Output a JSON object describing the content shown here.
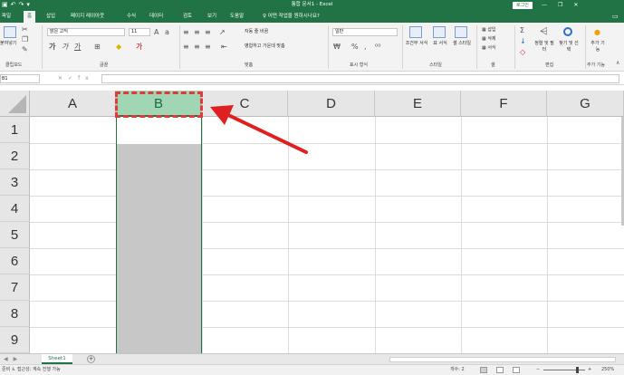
{
  "window": {
    "title": "통합 문서1 - Excel",
    "login_label": "로그인",
    "qat_icons": [
      "save-icon",
      "undo-icon",
      "redo-icon",
      "customize-icon"
    ],
    "controls": [
      "minimize-icon",
      "restore-icon",
      "close-icon"
    ]
  },
  "tabs": [
    "파일",
    "홈",
    "삽입",
    "페이지 레이아웃",
    "수식",
    "데이터",
    "검토",
    "보기",
    "도움말"
  ],
  "active_tab": "홈",
  "tell_me": "어떤 작업을 원하시나요?",
  "ribbon": {
    "clipboard": {
      "paste_label": "붙여넣기",
      "group": "클립보드"
    },
    "font": {
      "name": "맑은 고딕",
      "size": "11",
      "group": "글꼴"
    },
    "alignment": {
      "wrap_text": "자동 줄 바꿈",
      "merge_center": "병합하고 가운데 맞춤",
      "group": "맞춤"
    },
    "number": {
      "format": "일반",
      "group": "표시 형식"
    },
    "styles": {
      "conditional": "조건부 서식",
      "table": "표 서식",
      "cell": "셀 스타일",
      "group": "스타일"
    },
    "cells": {
      "insert": "삽입",
      "delete": "삭제",
      "format": "서식",
      "group": "셀"
    },
    "editing": {
      "sort": "정렬 및 필터",
      "find": "찾기 및 선택",
      "group": "편집"
    },
    "addins": {
      "label": "추가 기능",
      "group": "추가 기능"
    }
  },
  "formula_bar": {
    "name_box": "B1",
    "value": ""
  },
  "grid": {
    "columns": [
      "A",
      "B",
      "C",
      "D",
      "E",
      "F",
      "G"
    ],
    "rows": [
      "1",
      "2",
      "3",
      "4",
      "5",
      "6",
      "7",
      "8",
      "9"
    ],
    "selected_column": "B"
  },
  "sheets": [
    "Sheet1"
  ],
  "status": {
    "left": "준비",
    "accessibility": "접근성: 계속 진행 가능",
    "count": "개수: 2",
    "zoom": "250%"
  },
  "colors": {
    "brand": "#217346",
    "selected_header": "#a0d6b4",
    "annotation": "#e03a3a"
  }
}
